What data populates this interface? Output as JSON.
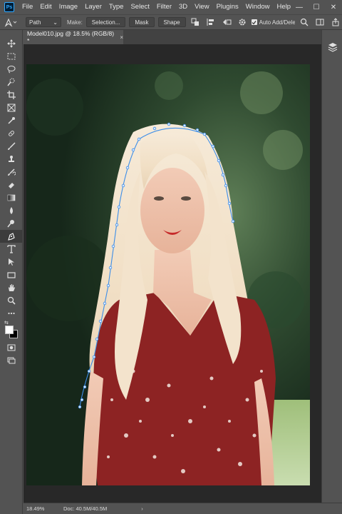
{
  "app": {
    "logo": "Ps"
  },
  "menu": [
    "File",
    "Edit",
    "Image",
    "Layer",
    "Type",
    "Select",
    "Filter",
    "3D",
    "View",
    "Plugins",
    "Window",
    "Help"
  ],
  "window_controls": {
    "minimize": "—",
    "maximize": "☐",
    "close": "✕"
  },
  "options": {
    "tool_mode": "Path",
    "make_label": "Make:",
    "selection_button": "Selection...",
    "mask_button": "Mask",
    "shape_button": "Shape",
    "auto_add_label": "Auto Add/Delete",
    "auto_add_checked": true
  },
  "document": {
    "tab_title": "Model010.jpg @ 18.5% (RGB/8) *",
    "close_glyph": "×"
  },
  "colors": {
    "foreground": "#ffffff",
    "background": "#000000",
    "ui_panel": "#535353",
    "canvas_bg": "#282828",
    "path_anchor": "#3d8ee8"
  },
  "tools": [
    "move-tool",
    "marquee-tool",
    "lasso-tool",
    "quick-selection-tool",
    "crop-tool",
    "frame-tool",
    "eyedropper-tool",
    "healing-brush-tool",
    "brush-tool",
    "clone-stamp-tool",
    "history-brush-tool",
    "eraser-tool",
    "gradient-tool",
    "blur-tool",
    "dodge-tool",
    "pen-tool",
    "type-tool",
    "path-selection-tool",
    "rectangle-tool",
    "hand-tool",
    "zoom-tool",
    "more-tools"
  ],
  "active_tool": "pen-tool",
  "status": {
    "zoom": "18.49%",
    "doc_size": "Doc: 40.5M/40.5M",
    "arrow": "›"
  }
}
